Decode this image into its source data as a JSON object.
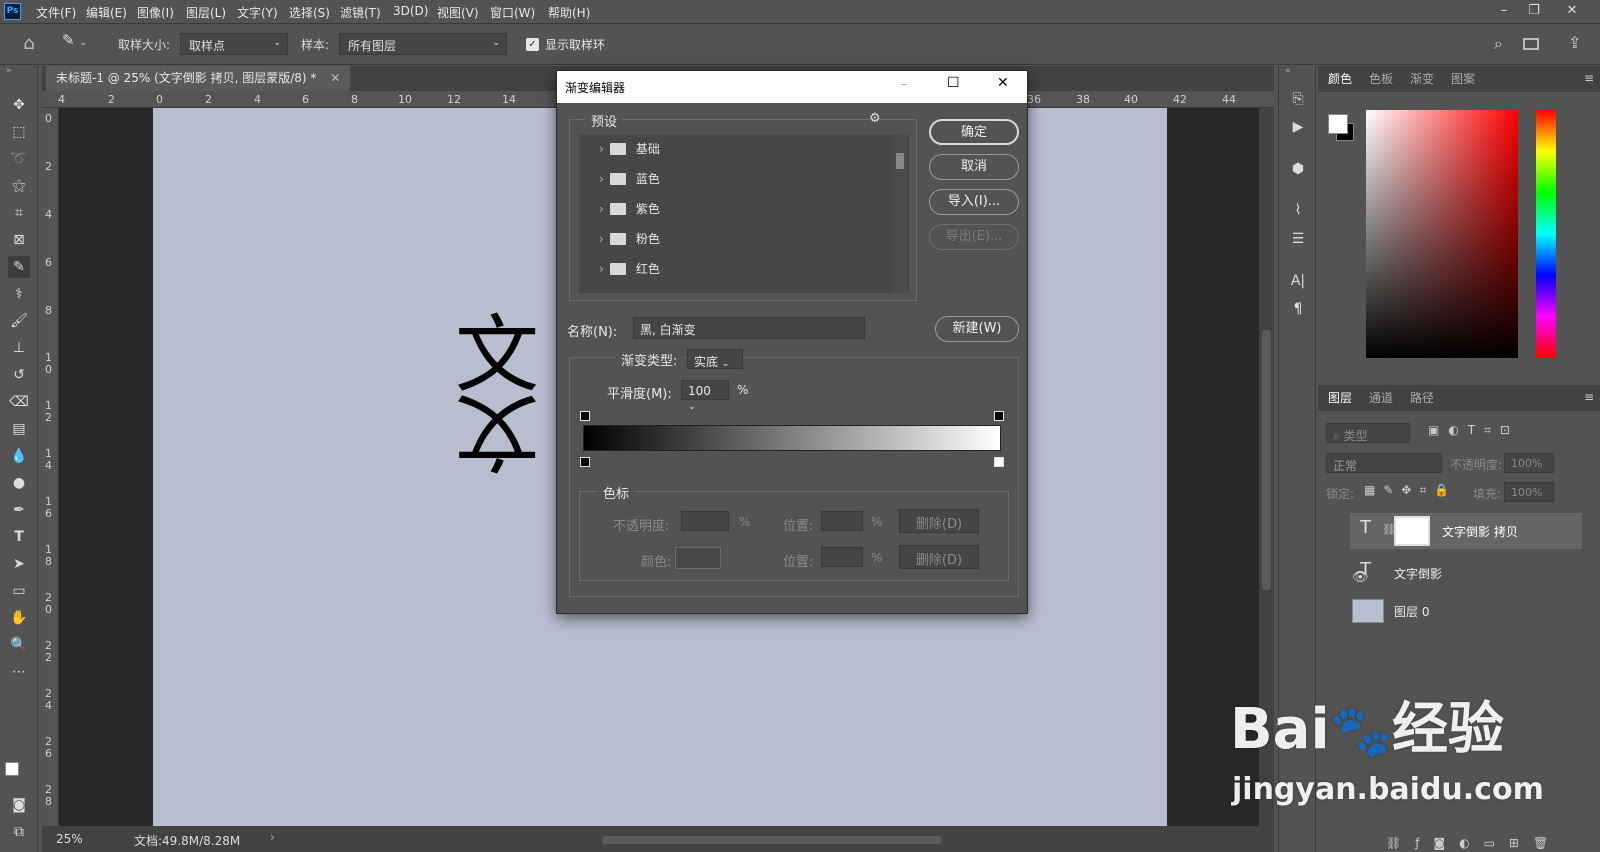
{
  "app": {
    "logo": "Ps"
  },
  "menubar": {
    "items": [
      "文件(F)",
      "编辑(E)",
      "图像(I)",
      "图层(L)",
      "文字(Y)",
      "选择(S)",
      "滤镜(T)",
      "3D(D)",
      "视图(V)",
      "窗口(W)",
      "帮助(H)"
    ]
  },
  "options": {
    "sample_size_label": "取样大小:",
    "sample_size_value": "取样点",
    "sample_label": "样本:",
    "sample_value": "所有图层",
    "show_ring_label": "显示取样环",
    "show_ring_checked": true
  },
  "document": {
    "tab_title": "未标题-1 @ 25% (文字倒影 拷贝, 图层蒙版/8) *",
    "canvas_text": "文",
    "canvas_color": "#b8bdd0"
  },
  "ruler": {
    "h_labels": [
      "4",
      "2",
      "0",
      "2",
      "4",
      "6",
      "8",
      "10",
      "12",
      "14",
      "36",
      "38",
      "40",
      "42",
      "44"
    ],
    "v_labels": [
      "0",
      "2",
      "4",
      "6",
      "8",
      "1 0",
      "1 2",
      "1 4",
      "1 6",
      "1 8",
      "2 0",
      "2 2",
      "2 4",
      "2 6",
      "2 8"
    ]
  },
  "status": {
    "zoom": "25%",
    "doc_info": "文档:49.8M/8.28M"
  },
  "dialog": {
    "title": "渐变编辑器",
    "presets_label": "预设",
    "presets": [
      "基础",
      "蓝色",
      "紫色",
      "粉色",
      "红色"
    ],
    "ok_label": "确定",
    "cancel_label": "取消",
    "import_label": "导入(I)...",
    "export_label": "导出(E)...",
    "name_label": "名称(N):",
    "name_value": "黑, 白渐变",
    "new_label": "新建(W)",
    "gradient_type_label": "渐变类型:",
    "gradient_type_value": "实底",
    "smoothness_label": "平滑度(M):",
    "smoothness_value": "100",
    "percent": "%",
    "stops_label": "色标",
    "opacity_label": "不透明度:",
    "position_label": "位置:",
    "color_label": "颜色:",
    "delete_label": "删除(D)",
    "gradient_start": "#000000",
    "gradient_end": "#ffffff"
  },
  "color_panel": {
    "tabs": [
      "颜色",
      "色板",
      "渐变",
      "图案"
    ],
    "active_tab": "颜色"
  },
  "layers_panel": {
    "tabs": [
      "图层",
      "通道",
      "路径"
    ],
    "active_tab": "图层",
    "filter_placeholder": "类型",
    "blend_mode": "正常",
    "opacity_label": "不透明度:",
    "opacity_value": "100%",
    "lock_label": "锁定:",
    "fill_label": "填充:",
    "fill_value": "100%",
    "layers": [
      {
        "name": "文字倒影 拷贝",
        "type": "text",
        "has_mask": true,
        "selected": true
      },
      {
        "name": "文字倒影",
        "type": "text",
        "has_mask": false,
        "selected": false
      },
      {
        "name": "图层 0",
        "type": "raster",
        "has_mask": false,
        "selected": false
      }
    ]
  },
  "watermark": {
    "brand": "Bai",
    "brand2": "经验",
    "url": "jingyan.baidu.com"
  }
}
